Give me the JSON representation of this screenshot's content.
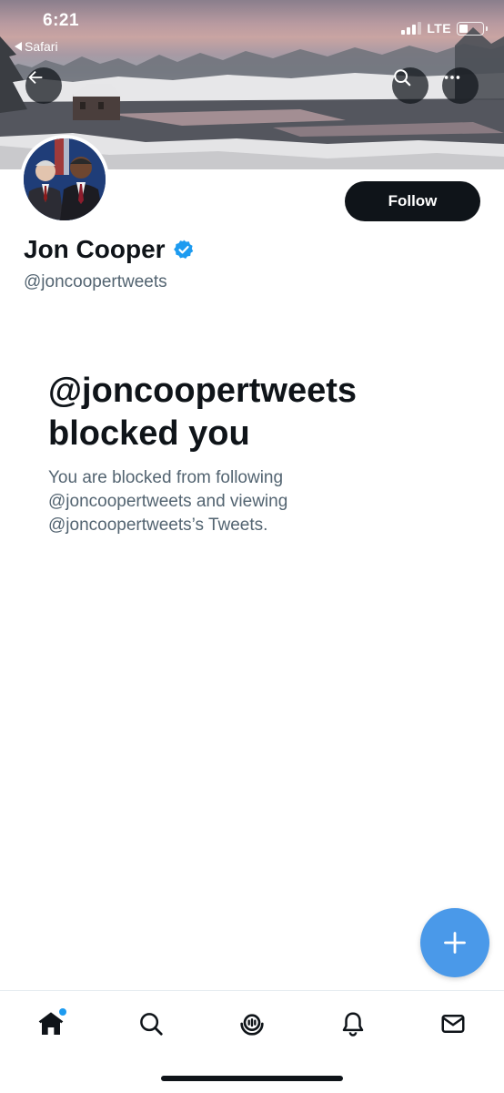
{
  "status_bar": {
    "time": "6:21",
    "back_app": "Safari",
    "network": "LTE",
    "signal_bars_active": 3,
    "signal_bars_total": 4,
    "battery_level_fraction": 0.3
  },
  "header": {
    "back_icon": "arrow-left-icon",
    "search_icon": "search-icon",
    "more_icon": "more-horizontal-icon"
  },
  "profile": {
    "display_name": "Jon Cooper",
    "handle": "@joncoopertweets",
    "verified": true,
    "follow_label": "Follow"
  },
  "blocked": {
    "title_line1": "@joncoopertweets",
    "title_line2": "blocked you",
    "description": "You are blocked from following @joncoopertweets and viewing @joncoopertweets’s Tweets."
  },
  "fab": {
    "icon": "plus-icon"
  },
  "bottom_nav": {
    "items": [
      {
        "name": "home",
        "icon": "home-icon",
        "active": true,
        "has_notification_dot": true
      },
      {
        "name": "explore",
        "icon": "search-icon",
        "active": false
      },
      {
        "name": "spaces",
        "icon": "spaces-icon",
        "active": false
      },
      {
        "name": "notifications",
        "icon": "bell-icon",
        "active": false
      },
      {
        "name": "messages",
        "icon": "mail-icon",
        "active": false
      }
    ]
  },
  "colors": {
    "accent": "#1d9bf0",
    "fab": "#4a99e9",
    "text_primary": "#0f1419",
    "text_secondary": "#536471",
    "follow_button_bg": "#0f1419"
  }
}
